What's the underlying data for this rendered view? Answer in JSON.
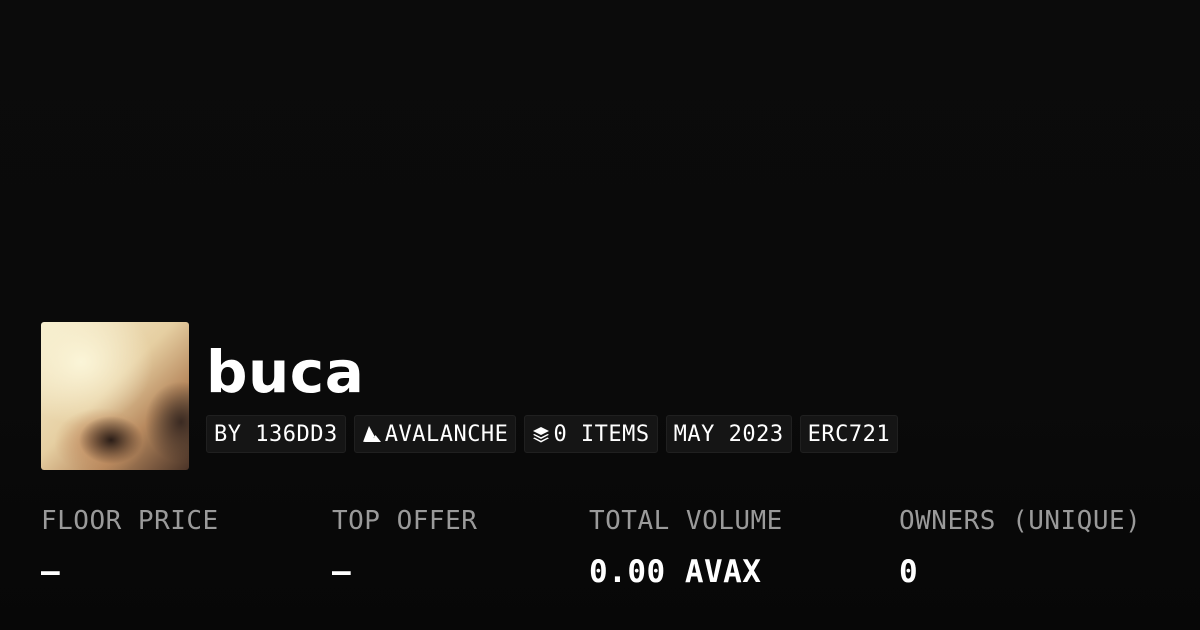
{
  "collection": {
    "name": "buca",
    "avatar_alt": ""
  },
  "tags": {
    "creator": "BY 136DD3",
    "chain": "AVALANCHE",
    "chain_icon": "avalanche-icon",
    "items": "0 ITEMS",
    "items_icon": "layers-icon",
    "date": "MAY 2023",
    "standard": "ERC721"
  },
  "stats": {
    "floor_price": {
      "label": "FLOOR PRICE",
      "value": "–"
    },
    "top_offer": {
      "label": "TOP OFFER",
      "value": "–"
    },
    "total_volume": {
      "label": "TOTAL VOLUME",
      "value": "0.00 AVAX"
    },
    "owners": {
      "label": "OWNERS (UNIQUE)",
      "value": "0"
    }
  },
  "colors": {
    "background": "#0c0c0c",
    "tag_background": "#151515",
    "label": "#9a9a9a",
    "text": "#ffffff"
  }
}
